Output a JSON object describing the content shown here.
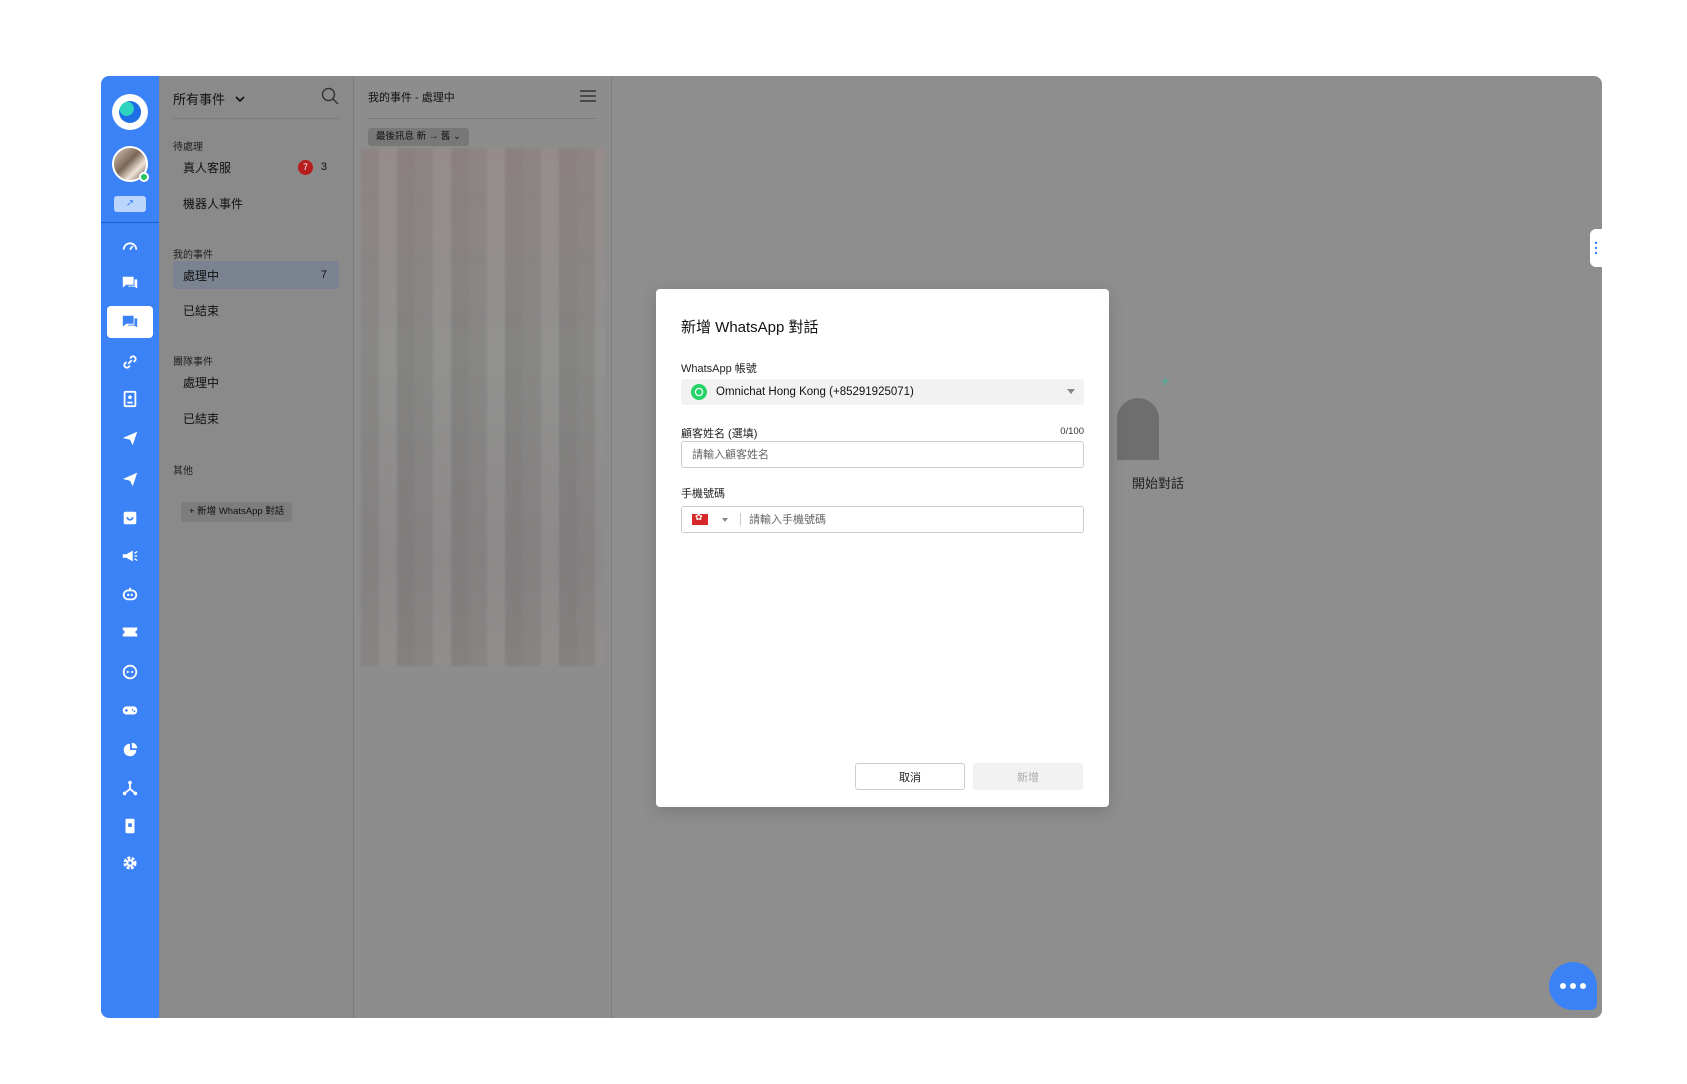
{
  "nav": {
    "header_title": "所有事件",
    "sections": [
      {
        "label": "待處理",
        "items": [
          {
            "label": "真人客服",
            "badge": "7",
            "count": "3"
          },
          {
            "label": "機器人事件"
          }
        ]
      },
      {
        "label": "我的事件",
        "items": [
          {
            "label": "處理中",
            "count": "7",
            "active": true
          },
          {
            "label": "已結束"
          }
        ]
      },
      {
        "label": "團隊事件",
        "items": [
          {
            "label": "處理中"
          },
          {
            "label": "已結束"
          }
        ]
      },
      {
        "label": "其他",
        "items": []
      }
    ],
    "add_whatsapp_label": "+ 新增 WhatsApp 對話"
  },
  "list": {
    "title": "我的事件 - 處理中",
    "sort_label": "最後訊息 新 → 舊 ⌄"
  },
  "main": {
    "empty_text": "開始對話"
  },
  "modal": {
    "title": "新增 WhatsApp 對話",
    "account_label": "WhatsApp 帳號",
    "account_value": "Omnichat Hong Kong (+85291925071)",
    "name_label": "顧客姓名 (選填)",
    "name_counter": "0/100",
    "name_placeholder": "請輸入顧客姓名",
    "phone_label": "手機號碼",
    "phone_placeholder": "請輸入手機號碼",
    "cancel_label": "取消",
    "submit_label": "新增"
  },
  "rail": {
    "icons": [
      "dashboard-icon",
      "chat-icon",
      "conversations-icon",
      "link-icon",
      "contacts-icon",
      "send-icon",
      "broadcast-icon",
      "store-icon",
      "megaphone-icon",
      "bot-icon",
      "ticket-icon",
      "face-icon",
      "gamepad-icon",
      "pie-chart-icon",
      "integration-icon",
      "device-icon",
      "gear-icon"
    ],
    "trend_label": "↗"
  },
  "colors": {
    "brand": "#3b82f6",
    "badge_red": "#b91c1c",
    "whatsapp_green": "#25d366"
  }
}
